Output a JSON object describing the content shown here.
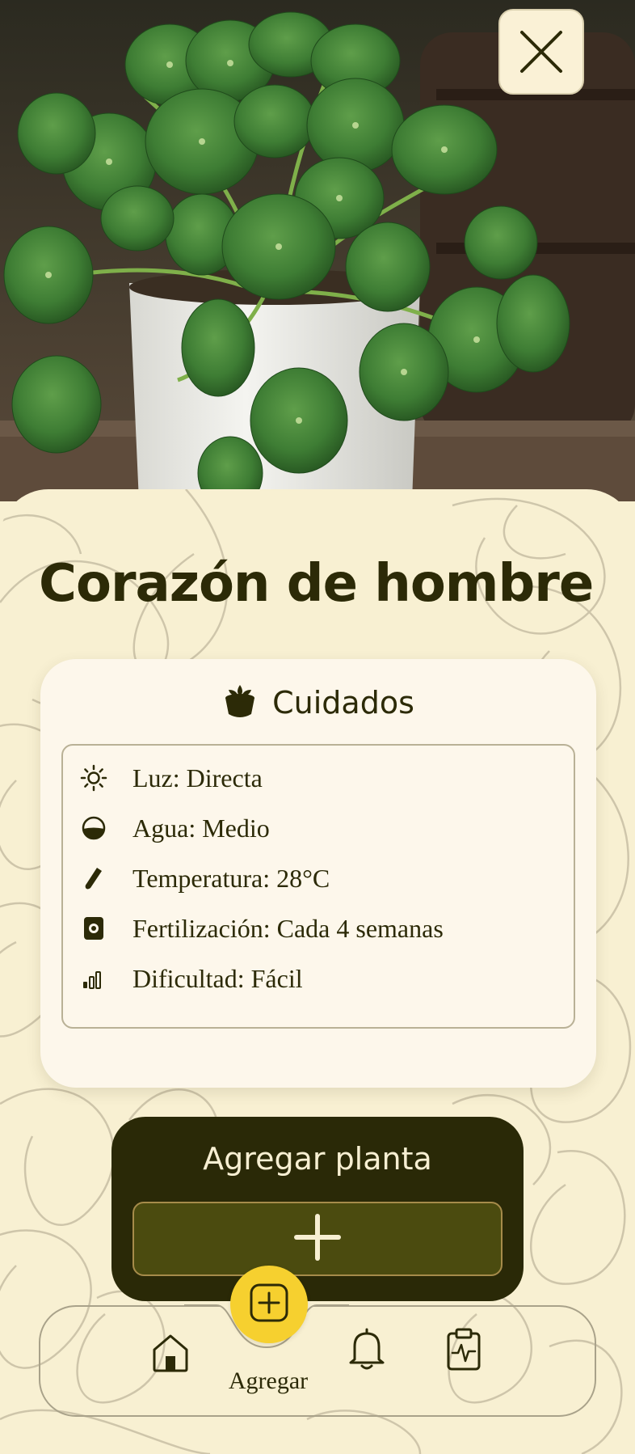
{
  "header": {
    "close_icon": "close-icon"
  },
  "plant": {
    "name": "Corazón de hombre"
  },
  "care": {
    "title": "Cuidados",
    "title_icon": "plant-pot-icon",
    "items": [
      {
        "icon": "sun-icon",
        "label": "Luz: Directa"
      },
      {
        "icon": "water-drop-icon",
        "label": "Agua: Medio"
      },
      {
        "icon": "thermometer-icon",
        "label": "Temperatura: 28°C"
      },
      {
        "icon": "fertilizer-bag-icon",
        "label": "Fertilización: Cada 4 semanas"
      },
      {
        "icon": "signal-bars-icon",
        "label": "Dificultad: Fácil"
      }
    ]
  },
  "add_panel": {
    "title": "Agregar planta",
    "button_icon": "plus-icon"
  },
  "nav": {
    "items": [
      {
        "icon": "home-icon",
        "label": ""
      },
      {
        "icon": "add-square-icon",
        "label": "Agregar",
        "active": true
      },
      {
        "icon": "bell-icon",
        "label": ""
      },
      {
        "icon": "clipboard-pulse-icon",
        "label": ""
      }
    ]
  },
  "colors": {
    "background": "#f8f0d2",
    "card": "#fdf7eb",
    "dark": "#2a2907",
    "olive": "#4b4b0f",
    "accent_yellow": "#f6d02f",
    "text": "#2c2a07"
  }
}
